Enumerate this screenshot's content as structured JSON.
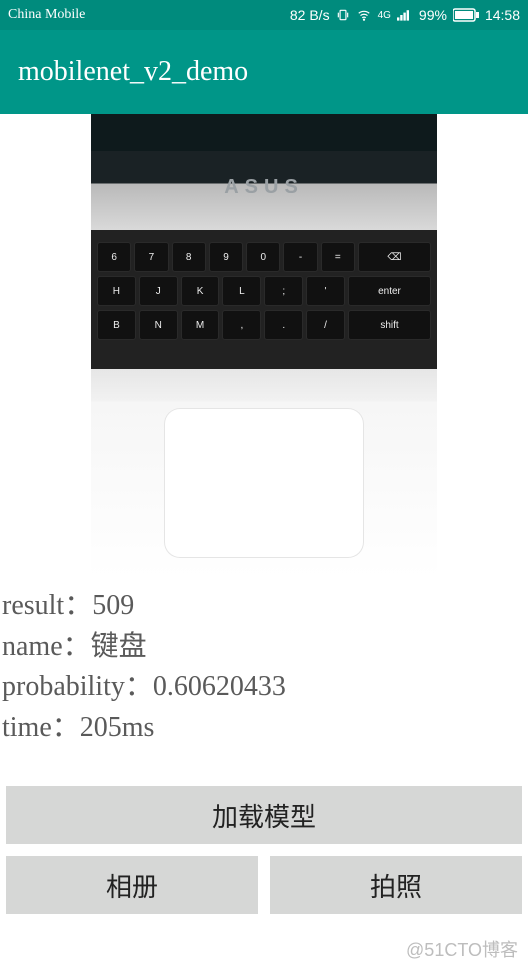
{
  "status": {
    "carrier": "China Mobile",
    "speed": "82 B/s",
    "network_label": "4G",
    "battery_pct": "99%",
    "time": "14:58"
  },
  "header": {
    "title": "mobilenet_v2_demo"
  },
  "image": {
    "brand": "ASUS"
  },
  "results": {
    "result_label": "result：",
    "result_value": "509",
    "name_label": "name：",
    "name_value": "键盘",
    "prob_label": "probability：",
    "prob_value": "0.60620433",
    "time_label": "time：",
    "time_value": "205ms"
  },
  "buttons": {
    "load_model": "加载模型",
    "album": "相册",
    "camera": "拍照"
  },
  "watermark": "@51CTO博客"
}
